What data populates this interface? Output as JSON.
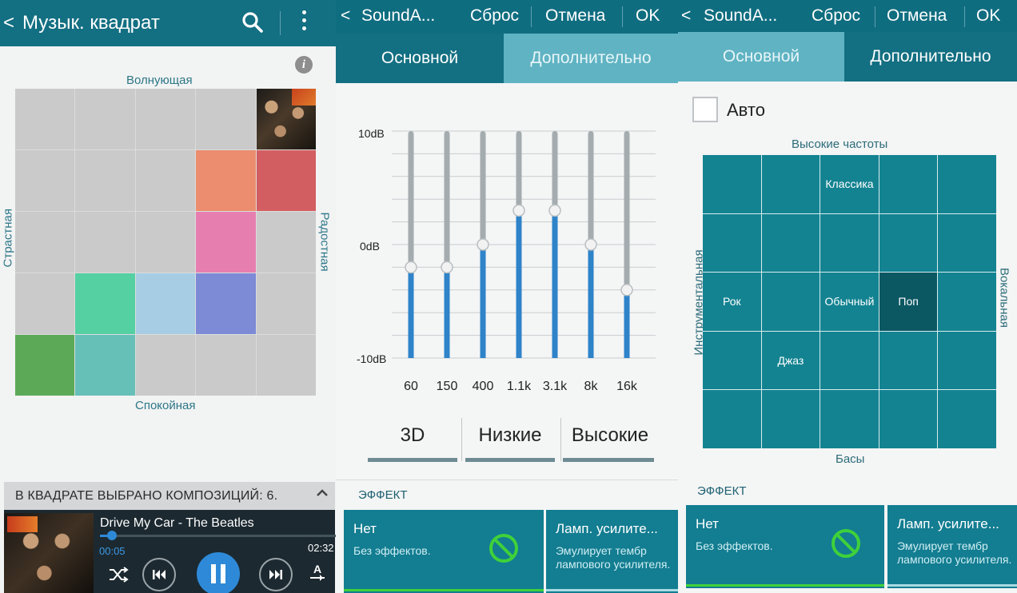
{
  "music_square": {
    "back_glyph": "<",
    "title": "Музык. квадрат",
    "search_icon": "search-icon",
    "more_icon": "more-vert-icon",
    "info_glyph": "i",
    "labels": {
      "top": "Волнующая",
      "bottom": "Спокойная",
      "left": "Страстная",
      "right": "Радостная"
    },
    "grid": [
      [
        "#cacaca",
        "#cacaca",
        "#cacaca",
        "#cacaca",
        "album"
      ],
      [
        "#cacaca",
        "#cacaca",
        "#cacaca",
        "#eb8d6e",
        "#d35e61"
      ],
      [
        "#cacaca",
        "#cacaca",
        "#cacaca",
        "#e67fb0",
        "#cacaca"
      ],
      [
        "#cacaca",
        "#54d0a2",
        "#a7cde5",
        "#7d8ad6",
        "#cacaca"
      ],
      [
        "#5caa58",
        "#67c0b8",
        "#cacaca",
        "#cacaca",
        "#cacaca"
      ]
    ]
  },
  "now_playing": {
    "header": "В КВАДРАТЕ ВЫБРАНО КОМПОЗИЦИЙ: 6.",
    "title": "Drive My Car - The Beatles",
    "current_time": "00:05",
    "duration": "02:32",
    "progress": 0.05
  },
  "soundalive_eq": {
    "back_glyph": "<",
    "title": "SoundA...",
    "reset": "Сброс",
    "cancel": "Отмена",
    "ok": "OK",
    "tabs": [
      "Основной",
      "Дополнительно"
    ],
    "active_tab": 1,
    "db_labels": [
      "10dB",
      "0dB",
      "-10dB"
    ],
    "bands": [
      {
        "label": "60",
        "value": -2
      },
      {
        "label": "150",
        "value": -2
      },
      {
        "label": "400",
        "value": 0
      },
      {
        "label": "1.1k",
        "value": 3
      },
      {
        "label": "3.1k",
        "value": 3
      },
      {
        "label": "8k",
        "value": 0
      },
      {
        "label": "16k",
        "value": -4
      }
    ],
    "bottom_tabs": [
      "3D",
      "Низкие",
      "Высокие"
    ],
    "effect_title": "ЭФФЕКТ",
    "effects": [
      {
        "name": "Нет",
        "desc": "Без эффектов.",
        "icon": "none-icon"
      },
      {
        "name": "Ламп. усилите...",
        "desc": "Эмулирует тембр лампового усилителя."
      }
    ]
  },
  "soundalive_square": {
    "back_glyph": "<",
    "title": "SoundA...",
    "reset": "Сброс",
    "cancel": "Отмена",
    "ok": "OK",
    "tabs": [
      "Основной",
      "Дополнительно"
    ],
    "active_tab": 0,
    "auto_label": "Авто",
    "auto_checked": false,
    "labels": {
      "top": "Высокие частоты",
      "bottom": "Басы",
      "left": "Инструментальная",
      "right": "Вокальная"
    },
    "cells": [
      [
        "",
        "",
        "Классика",
        "",
        ""
      ],
      [
        "",
        "",
        "",
        "",
        ""
      ],
      [
        "Рок",
        "",
        "Обычный",
        "Поп",
        ""
      ],
      [
        "",
        "Джаз",
        "",
        "",
        ""
      ],
      [
        "",
        "",
        "",
        "",
        ""
      ]
    ],
    "selected_cell": [
      2,
      3
    ],
    "effect_title": "ЭФФЕКТ",
    "effects": [
      {
        "name": "Нет",
        "desc": "Без эффектов.",
        "icon": "none-icon"
      },
      {
        "name": "Ламп. усилите...",
        "desc": "Эмулирует тембр лампового усилителя."
      }
    ]
  },
  "colors": {
    "appbar": "#136f82",
    "tab_dark": "#136f82",
    "tab_active_light": "#5fb3c3",
    "accent_blue": "#2e8ad8",
    "green_ok": "#3fd13a"
  }
}
